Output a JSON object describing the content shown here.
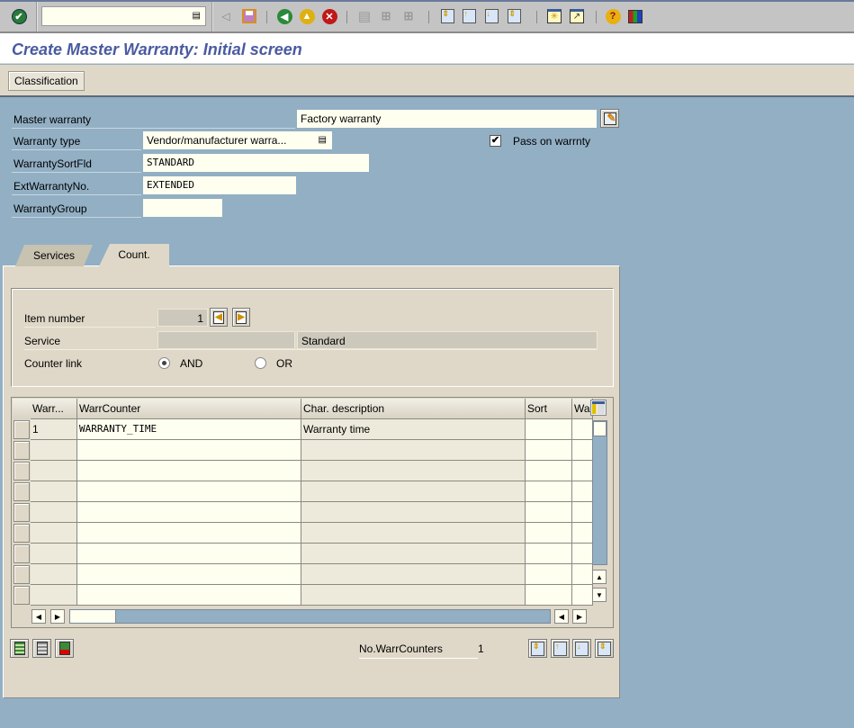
{
  "toolbar": {
    "command_field_value": "",
    "icons": [
      "enter-icon",
      "command-history-icon",
      "back-arrow-icon",
      "save-icon",
      "back-icon",
      "exit-icon",
      "cancel-icon",
      "print-icon",
      "find-icon",
      "find-next-icon",
      "first-page-icon",
      "previous-page-icon",
      "next-page-icon",
      "last-page-icon",
      "create-session-icon",
      "shortcut-icon",
      "help-icon",
      "layout-menu-icon"
    ]
  },
  "title": "Create Master Warranty: Initial screen",
  "app_toolbar": {
    "classification_label": "Classification"
  },
  "header": {
    "master_warranty": {
      "label": "Master warranty",
      "value": "Factory warranty"
    },
    "warranty_type": {
      "label": "Warranty type",
      "value": "Vendor/manufacturer warra..."
    },
    "pass_on": {
      "label": "Pass on warrnty",
      "checked": true
    },
    "sort_field": {
      "label": "WarrantySortFld",
      "value": "STANDARD"
    },
    "ext_no": {
      "label": "ExtWarrantyNo.",
      "value": "EXTENDED"
    },
    "group": {
      "label": "WarrantyGroup",
      "value": ""
    }
  },
  "tabs": [
    {
      "label": "Services",
      "active": false
    },
    {
      "label": "Count.",
      "active": true
    }
  ],
  "counter": {
    "item_number": {
      "label": "Item number",
      "value": "1"
    },
    "service": {
      "label": "Service",
      "value": "",
      "description": "Standard"
    },
    "counter_link": {
      "label": "Counter link",
      "options": [
        {
          "label": "AND",
          "selected": true
        },
        {
          "label": "OR",
          "selected": false
        }
      ]
    }
  },
  "table": {
    "columns": [
      "Warr...",
      "WarrCounter",
      "Char. description",
      "Sort",
      "Wa"
    ],
    "rows": [
      [
        "1",
        "WARRANTY_TIME",
        "Warranty time",
        "",
        ""
      ],
      [
        "",
        "",
        "",
        "",
        ""
      ],
      [
        "",
        "",
        "",
        "",
        ""
      ],
      [
        "",
        "",
        "",
        "",
        ""
      ],
      [
        "",
        "",
        "",
        "",
        ""
      ],
      [
        "",
        "",
        "",
        "",
        ""
      ],
      [
        "",
        "",
        "",
        "",
        ""
      ],
      [
        "",
        "",
        "",
        "",
        ""
      ],
      [
        "",
        "",
        "",
        "",
        ""
      ]
    ]
  },
  "footer": {
    "count_label": "No.WarrCounters",
    "count_value": "1"
  }
}
